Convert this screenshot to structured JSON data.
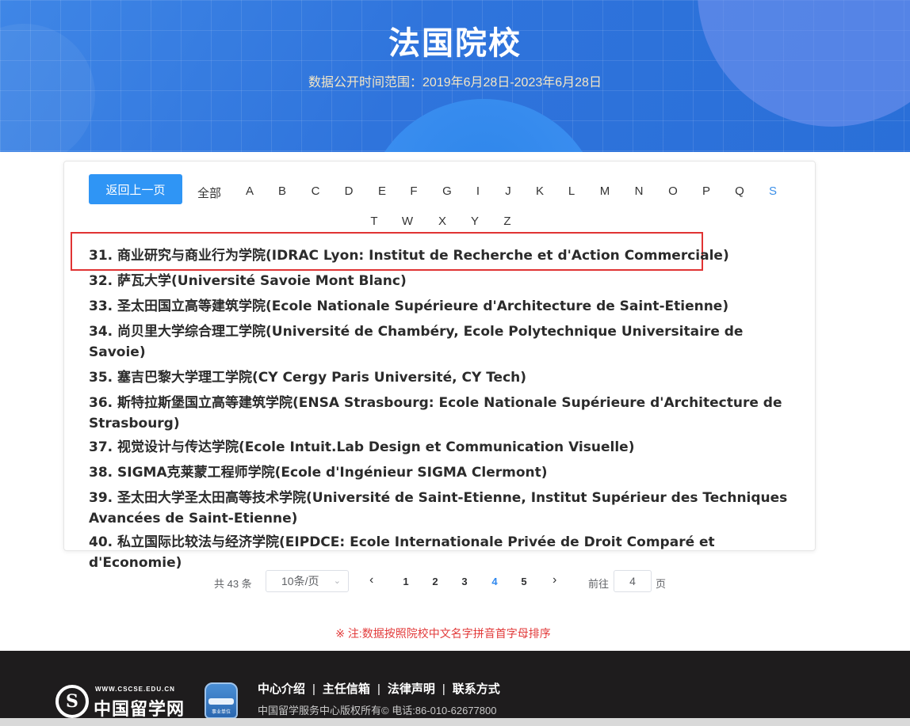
{
  "banner": {
    "title": "法国院校",
    "subtitle": "数据公开时间范围：2019年6月28日-2023年6月28日"
  },
  "nav": {
    "back_label": "返回上一页",
    "all_label": "全部",
    "letters": [
      "A",
      "B",
      "C",
      "D",
      "E",
      "F",
      "G",
      "I",
      "J",
      "K",
      "L",
      "M",
      "N",
      "O",
      "P",
      "Q",
      "S",
      "T",
      "W",
      "X",
      "Y",
      "Z"
    ],
    "active_letter": "S"
  },
  "schools": [
    "31.  商业研究与商业行为学院(IDRAC Lyon: Institut de Recherche et d'Action Commerciale)",
    "32.  萨瓦大学(Université Savoie Mont Blanc)",
    "33.  圣太田国立高等建筑学院(Ecole Nationale Supérieure d'Architecture de Saint-Etienne)",
    "34.  尚贝里大学综合理工学院(Université de Chambéry, Ecole Polytechnique Universitaire de Savoie)",
    "35.  塞吉巴黎大学理工学院(CY Cergy Paris Université, CY Tech)",
    "36.  斯特拉斯堡国立高等建筑学院(ENSA Strasbourg: Ecole Nationale Supérieure d'Architecture de Strasbourg)",
    "37.  视觉设计与传达学院(Ecole Intuit.Lab Design et Communication Visuelle)",
    "38.  SIGMA克莱蒙工程师学院(Ecole d'Ingénieur SIGMA Clermont)",
    "39.  圣太田大学圣太田高等技术学院(Université de Saint-Etienne, Institut Supérieur des Techniques Avancées de Saint-Etienne)",
    "40.  私立国际比较法与经济学院(EIPDCE: Ecole Internationale Privée de Droit Comparé et d'Economie)"
  ],
  "pagination": {
    "total_label": "共 43 条",
    "page_size": "10条/页",
    "pages": [
      "1",
      "2",
      "3",
      "4",
      "5"
    ],
    "current_page": "4",
    "prev_icon": "‹",
    "next_icon": "›",
    "goto_label": "前往",
    "goto_value": "4",
    "page_suffix": "页"
  },
  "note": "※ 注:数据按照院校中文名字拼音首字母排序",
  "footer": {
    "logo_url": "WWW.CSCSE.EDU.CN",
    "logo_name": "中国留学网",
    "badge_text": "事业单位",
    "links": [
      "中心介绍",
      "主任信箱",
      "法律声明",
      "联系方式"
    ],
    "copyright": "中国留学服务中心版权所有©    电话:86-010-62677800"
  },
  "colors": {
    "banner_blue": "#2f74dc",
    "button_blue": "#2f95f5",
    "active_blue": "#3b8fe8",
    "highlight_red": "#e03333",
    "footer_bg": "#1e1c1d"
  }
}
